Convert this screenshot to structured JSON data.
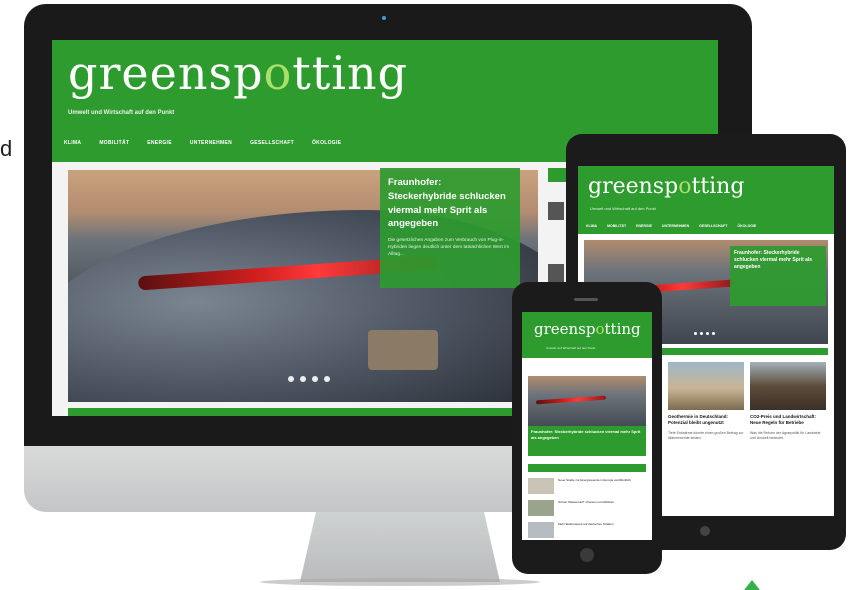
{
  "stray_letter": "d",
  "desktop": {
    "logo_main": "greensp",
    "logo_o": "o",
    "logo_end": "tting",
    "tagline": "Umwelt und Wirtschaft auf den Punkt",
    "nav": [
      "KLIMA",
      "MOBILITÄT",
      "ENERGIE",
      "UNTERNEHMEN",
      "GESELLSCHAFT",
      "ÖKOLOGIE"
    ],
    "hero_title": "Fraunhofer: Steckerhybride schlucken viermal mehr Sprit als angegeben",
    "hero_teaser": "Die gesetzlichen Angaben zum Verbrauch von Plug-in-Hybriden liegen deutlich unter dem tatsächlichen Wert im Alltag..."
  },
  "tablet": {
    "logo_main": "greensp",
    "logo_o": "o",
    "logo_end": "tting",
    "tagline": "Umwelt und Wirtschaft auf den Punkt",
    "nav": [
      "KLIMA",
      "MOBILITÄT",
      "ENERGIE",
      "UNTERNEHMEN",
      "GESELLSCHAFT",
      "ÖKOLOGIE"
    ],
    "hero_title": "Fraunhofer: Steckerhybride schlucken viermal mehr Sprit als angegeben",
    "cards": [
      {
        "title": "Geothermie in Deutschland: Potenzial bleibt ungenutzt",
        "text": "Tiefe Erdwärme könnte einen großen Beitrag zur Wärmewende leisten."
      },
      {
        "title": "CO2-Preis und Landwirtschaft: Neue Regeln für Betriebe",
        "text": "Was die Reform der Agrarpolitik für Landwirte und Umwelt bedeutet."
      }
    ]
  },
  "phone": {
    "logo_main": "greensp",
    "logo_o": "o",
    "logo_end": "tting",
    "tagline": "Umwelt und Wirtschaft auf den Punkt",
    "hero_title": "Fraunhofer: Steckerhybride schlucken viermal mehr Sprit als angegeben",
    "section_label": "AKTUELLE ARTIKEL",
    "items": [
      "Neue Studie zur Energiewende in Europa veröffentlicht",
      "Grüner Wasserstoff: Chancen und Risiken",
      "Mehr Elektroautos auf deutschen Straßen"
    ]
  },
  "colors": {
    "brand_green": "#2e9b2f",
    "logo_accent": "#a8e06b",
    "device_frame": "#1a1a1a"
  }
}
